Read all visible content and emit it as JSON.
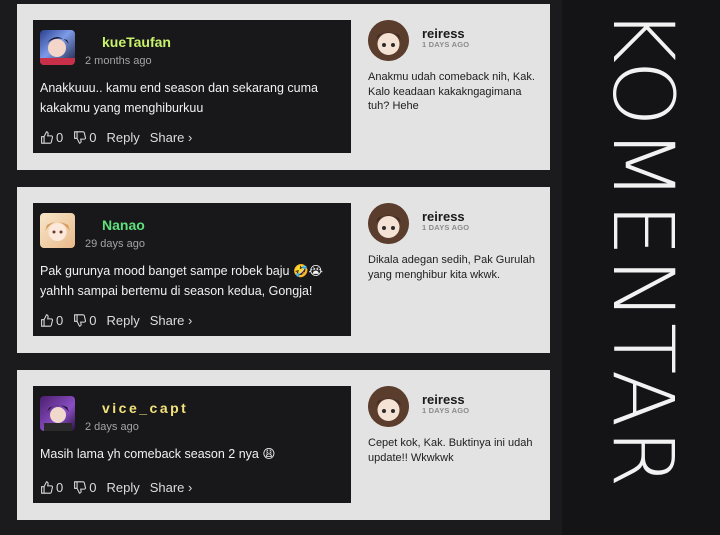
{
  "side_title": "KOMENTAR",
  "threads": [
    {
      "comment": {
        "username": "kueTaufan",
        "username_color": "#c8f26a",
        "time": "2 months ago",
        "text": "Anakkuuu.. kamu end season dan sekarang cuma kakakmu yang menghiburkuu",
        "likes": "0",
        "dislikes": "0",
        "reply_label": "Reply",
        "share_label": "Share ›"
      },
      "reply": {
        "username": "reiress",
        "time": "1 DAYS AGO",
        "text": "Anakmu udah comeback nih, Kak. Kalo keadaan kakakngagimana tuh? Hehe"
      }
    },
    {
      "comment": {
        "username": "Nanao",
        "username_color": "#5fe07a",
        "time": "29 days ago",
        "text": "Pak gurunya mood banget sampe robek baju 🤣😭 yahhh sampai bertemu di season kedua, Gongja!",
        "likes": "0",
        "dislikes": "0",
        "reply_label": "Reply",
        "share_label": "Share ›"
      },
      "reply": {
        "username": "reiress",
        "time": "1 DAYS AGO",
        "text": "Dikala adegan sedih, Pak Gurulah yang menghibur kita wkwk."
      }
    },
    {
      "comment": {
        "username": "vice_capt",
        "username_color": "#f3e27a",
        "time": "2 days ago",
        "text": "Masih lama yh comeback season 2 nya 😩",
        "likes": "0",
        "dislikes": "0",
        "reply_label": "Reply",
        "share_label": "Share ›"
      },
      "reply": {
        "username": "reiress",
        "time": "1 DAYS AGO",
        "text": "Cepet kok, Kak. Buktinya ini udah update!! Wkwkwk"
      }
    }
  ]
}
